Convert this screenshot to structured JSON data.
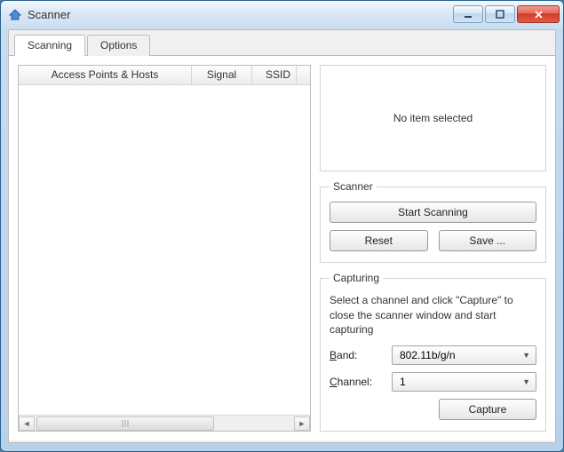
{
  "window": {
    "title": "Scanner"
  },
  "tabs": {
    "scanning": "Scanning",
    "options": "Options"
  },
  "list": {
    "col_access_points": "Access Points & Hosts",
    "col_signal": "Signal",
    "col_ssid": "SSID"
  },
  "preview": {
    "empty": "No item selected"
  },
  "scanner": {
    "legend": "Scanner",
    "start": "Start Scanning",
    "reset": "Reset",
    "save": "Save ..."
  },
  "capturing": {
    "legend": "Capturing",
    "help": "Select a channel and click \"Capture\" to close the scanner window and start capturing",
    "band_label_pre": "B",
    "band_label_post": "and:",
    "channel_label_pre": "C",
    "channel_label_post": "hannel:",
    "band_value": "802.11b/g/n",
    "channel_value": "1",
    "capture": "Capture"
  }
}
